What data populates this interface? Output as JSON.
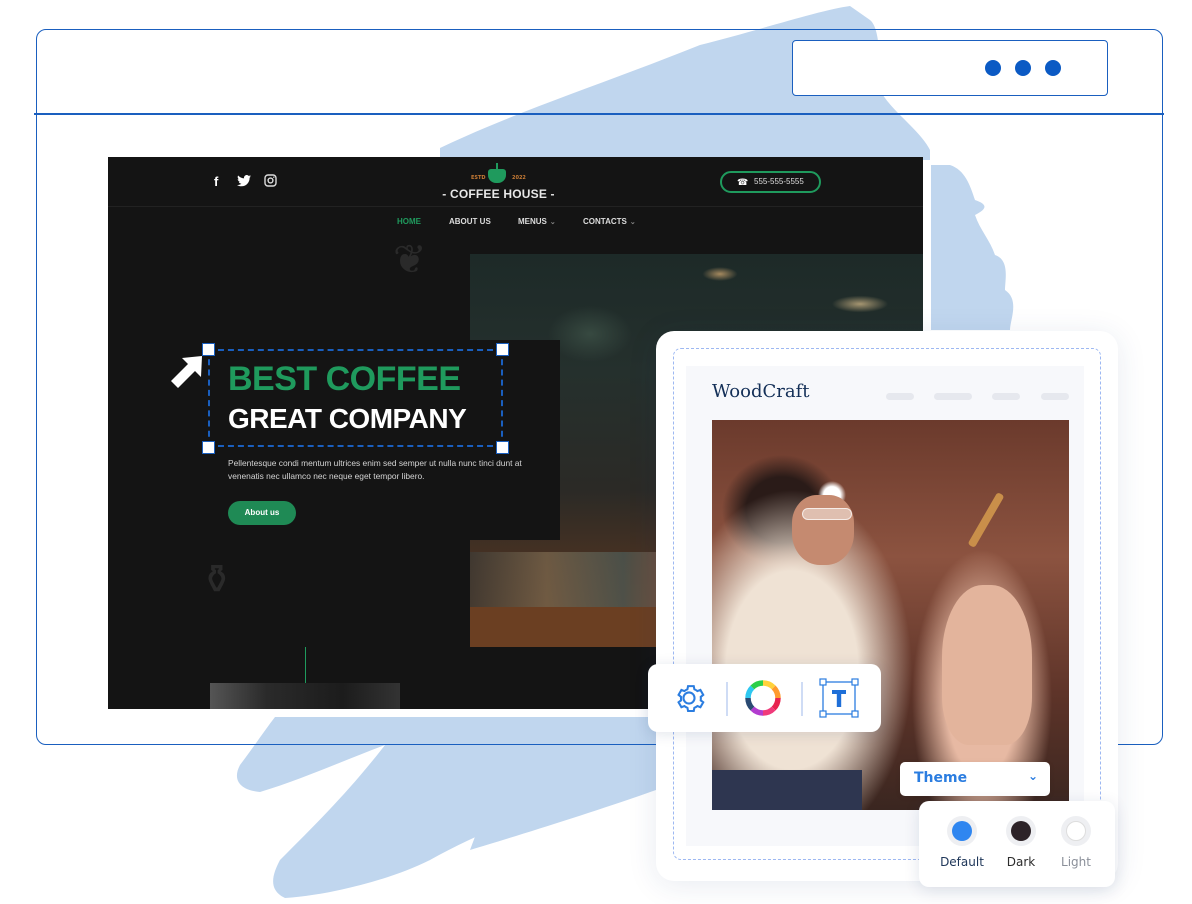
{
  "browser": {
    "window_dots": [
      "dot-1",
      "dot-2",
      "dot-3"
    ]
  },
  "coffee_site": {
    "social_icons": [
      "facebook-icon",
      "twitter-icon",
      "instagram-icon"
    ],
    "social_glyphs": [
      "f",
      "🐦",
      "◎"
    ],
    "logo": {
      "estd": "ESTD",
      "year": "2022",
      "name": "- COFFEE HOUSE -"
    },
    "phone": {
      "icon": "☎",
      "number": "555-555-5555"
    },
    "nav": [
      {
        "label": "HOME",
        "active": true
      },
      {
        "label": "ABOUT US",
        "active": false
      },
      {
        "label": "MENUS",
        "active": false,
        "has_dropdown": true
      },
      {
        "label": "CONTACTS",
        "active": false,
        "has_dropdown": true
      }
    ],
    "chevron": "⌄",
    "hero": {
      "title_line1": "BEST COFFEE",
      "title_line2": "GREAT COMPANY",
      "body": "Pellentesque condi mentum ultrices enim sed semper ut nulla nunc tinci dunt at venenatis nec ullamco nec neque eget tempor libero.",
      "button_label": "About us"
    }
  },
  "woodcraft": {
    "brand": "WoodCraft"
  },
  "toolbar": {
    "items": [
      "settings",
      "color-palette",
      "text-box"
    ],
    "text_glyph": "T"
  },
  "theme": {
    "label": "Theme",
    "chevron": "⌄",
    "options": [
      {
        "label": "Default",
        "color": "#2f86f0",
        "selected": true
      },
      {
        "label": "Dark",
        "color": "#2d2328",
        "selected": false
      },
      {
        "label": "Light",
        "color": "#ffffff",
        "selected": false
      }
    ]
  },
  "colors": {
    "frame_blue": "#1a5fbf",
    "brush_blue": "#c0d6ee",
    "coffee_green": "#1f9a5d",
    "theme_blue": "#2b7de0"
  }
}
